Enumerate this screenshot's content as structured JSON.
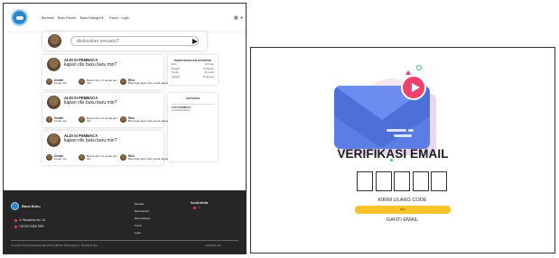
{
  "forum": {
    "nav": {
      "items": [
        "Beranda",
        "Buku Favorit",
        "Buku Kategori ▾",
        "Forum",
        "Login"
      ],
      "icons": [
        "grid-icon",
        "user-icon"
      ]
    },
    "search": {
      "placeholder": "diskusikan sesuatu?"
    },
    "posts": [
      {
        "author": "ALDI SI PEMBACA",
        "text": "kapan rilis buku baru min?",
        "replies": [
          {
            "name": "Uswah",
            "text": "besok min"
          },
          {
            "name": "",
            "text": "Besok rilis min setiap jam rilis"
          },
          {
            "name": "Riko",
            "text": "Bisa login akun baru untuk akses ke buku"
          }
        ]
      },
      {
        "author": "ALDI SI PEMBACA",
        "text": "kapan rilis buku baru min?",
        "replies": [
          {
            "name": "Uswah",
            "text": "besok min"
          },
          {
            "name": "",
            "text": "Besok rilis min setiap jam rilis"
          },
          {
            "name": "Riko",
            "text": "Bisa login akun baru untuk akses ke buku"
          }
        ]
      },
      {
        "author": "ALDI SI PEMBACA",
        "text": "kapan rilis buku baru min?",
        "replies": [
          {
            "name": "Uswah",
            "text": "besok min"
          },
          {
            "name": "",
            "text": "Besok rilis min setiap jam rilis"
          },
          {
            "name": "Riko",
            "text": "Bisa login akun baru untuk akses ke buku"
          }
        ]
      }
    ],
    "stats": {
      "title": "PERPUSTAKAAN STATISTIK",
      "rows": [
        {
          "label": "Buku",
          "value": "100 buku"
        },
        {
          "label": "Kategori",
          "value": "10 kategori"
        },
        {
          "label": "Penulis",
          "value": "20 penulis"
        },
        {
          "label": "Anggota",
          "value": "50 anggota"
        }
      ]
    },
    "activity": {
      "title": "AKTIVITAS",
      "item_title": "ALDI SI PEMBACA",
      "item_text": "menambah diskusi"
    },
    "footer": {
      "brand": "Baca Buku",
      "address": "Jl. Nusantara No. 14",
      "phone": "+62 822 3456 7890",
      "links": [
        "Beranda",
        "Buku Favorit",
        "Buku Kategori",
        "Forum",
        "Login"
      ],
      "social_title": "Social Media",
      "copyright": "Copyright 2023 Perpustakaan Baca Buku SMKN 8 Tanjungpinang - Kepulauan Riau",
      "credit": "Created by Aldi"
    }
  },
  "verification": {
    "title": "VERIFIKASI EMAIL",
    "code_boxes": 5,
    "resend_label": "KIRIM ULANG CODE",
    "send_label": "Kirim",
    "change_email_label": "GANTI EMAIL"
  },
  "colors": {
    "accent_yellow": "#f7c328",
    "envelope_blue": "#4f6fd8",
    "play_pink": "#ef3f6d",
    "footer_dark": "#262626",
    "brand_blue": "#2c86c7"
  }
}
